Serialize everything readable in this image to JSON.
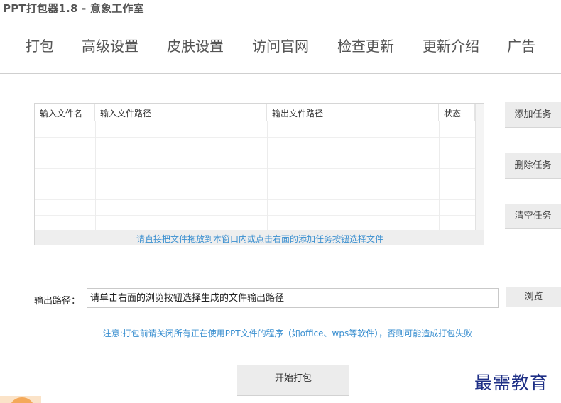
{
  "window": {
    "title": "PPT打包器1.8 - 意象工作室"
  },
  "menu": {
    "items": [
      {
        "label": "打包"
      },
      {
        "label": "高级设置"
      },
      {
        "label": "皮肤设置"
      },
      {
        "label": "访问官网"
      },
      {
        "label": "检查更新"
      },
      {
        "label": "更新介绍"
      },
      {
        "label": "广告"
      }
    ]
  },
  "task_table": {
    "columns": [
      "输入文件名",
      "输入文件路径",
      "输出文件路径",
      "状态"
    ],
    "rows": [],
    "drop_hint": "请直接把文件拖放到本窗口内或点击右面的添加任务按钮选择文件"
  },
  "actions": {
    "add_task": "添加任务",
    "delete_task": "删除任务",
    "clear_tasks": "清空任务"
  },
  "output": {
    "label": "输出路径：",
    "value": "请单击右面的浏览按钮选择生成的文件输出路径",
    "browse": "浏览"
  },
  "notice": "注意:打包前请关闭所有正在使用PPT文件的程序（如office、wps等软件），否则可能造成打包失败",
  "start_button": "开始打包",
  "watermark": "最需教育"
}
